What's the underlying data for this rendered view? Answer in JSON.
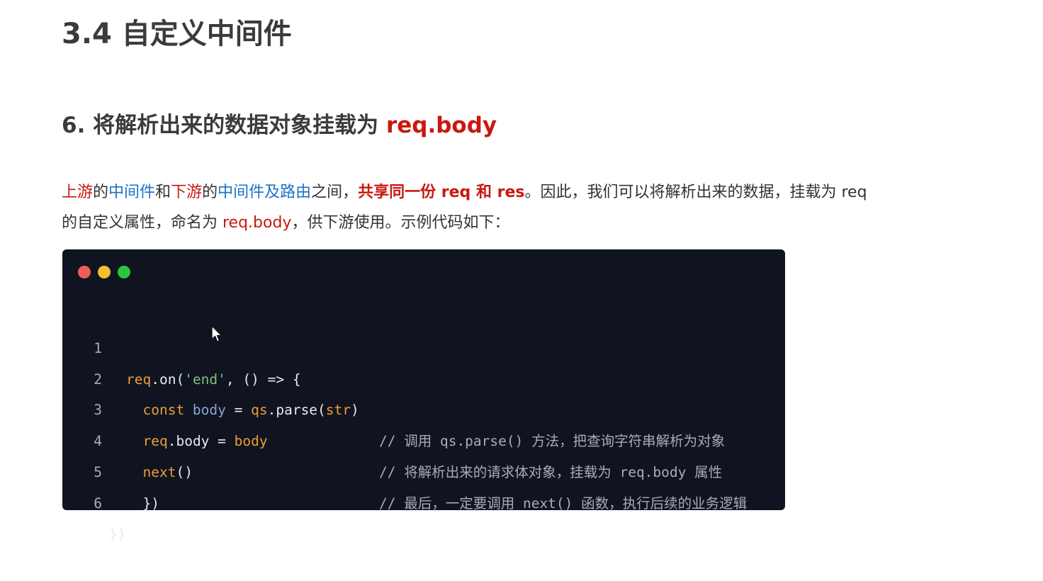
{
  "page_title": "3.4 自定义中间件",
  "section": {
    "prefix": "6. 将解析出来的数据对象挂载为 ",
    "accent": "req.body"
  },
  "paragraph": {
    "p1": "上游",
    "p2": "的",
    "p3": "中间件",
    "p4": "和",
    "p5": "下游",
    "p6": "的",
    "p7": "中间件及路由",
    "p8": "之间，",
    "p9": "共享同一份 req 和 res",
    "p10": "。因此，我们可以将解析出来的数据，挂载为 req",
    "p11": "的自定义属性，命名为 ",
    "p12": "req.body",
    "p13": "，供下游使用。示例代码如下："
  },
  "window_dots": {
    "red": "#ee5f57",
    "yellow": "#f5bd2f",
    "green": "#29c440"
  },
  "code": {
    "lines": [
      {
        "num": "1",
        "tokens": [
          "req",
          ".on(",
          "'end'",
          ", () => {"
        ],
        "comment": ""
      },
      {
        "num": "2",
        "tokens": [
          "  const ",
          "body",
          " = ",
          "qs",
          ".parse(",
          "str",
          ")"
        ],
        "comment": "// 调用 qs.parse() 方法，把查询字符串解析为对象"
      },
      {
        "num": "3",
        "tokens": [
          "  ",
          "req",
          ".body = ",
          "body"
        ],
        "comment": "// 将解析出来的请求体对象，挂载为 req.body 属性"
      },
      {
        "num": "4",
        "tokens": [
          "  ",
          "next",
          "()"
        ],
        "comment": "// 最后，一定要调用 next() 函数，执行后续的业务逻辑"
      },
      {
        "num": "5",
        "tokens": [
          "  })"
        ],
        "comment": ""
      },
      {
        "num": "6",
        "tokens": [
          "})"
        ],
        "comment": ""
      }
    ]
  },
  "colors": {
    "accent_red": "#c8190f",
    "link_blue": "#1a73c8",
    "code_bg": "#0f1420",
    "keyword_orange": "#f09a38",
    "string_green": "#7ec07a"
  }
}
